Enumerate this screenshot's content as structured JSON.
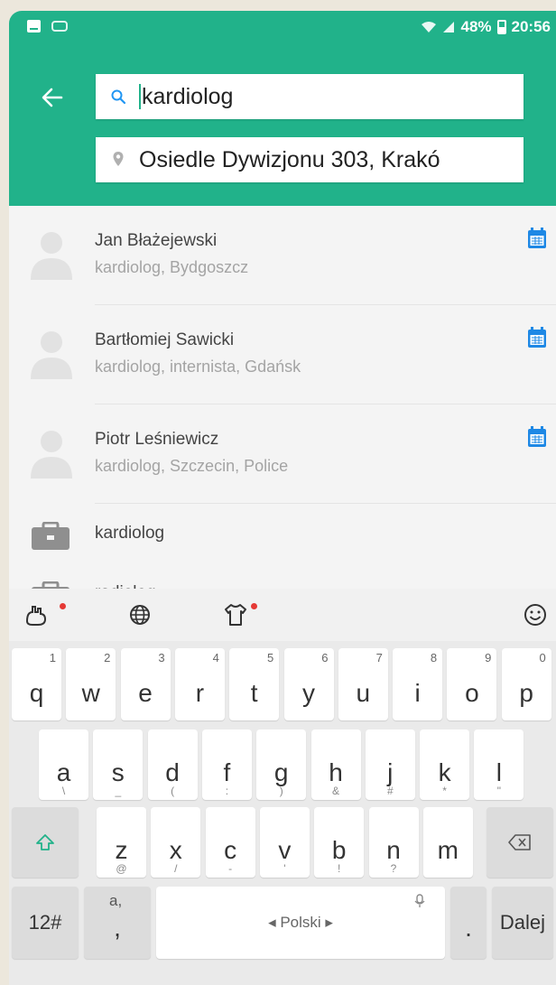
{
  "status_bar": {
    "battery": "48%",
    "time": "20:56"
  },
  "search": {
    "query": "kardiolog",
    "location": "Osiedle Dywizjonu 303, Krakó"
  },
  "colors": {
    "accent": "#21b28a",
    "calendar": "#1e88e5",
    "alert_dot": "#e53935"
  },
  "icons": {
    "back": "arrow-left-icon",
    "search": "search-icon",
    "location": "location-pin-icon",
    "calendar": "calendar-icon",
    "specialty": "briefcase-icon",
    "avatar": "person-placeholder-icon"
  },
  "results": [
    {
      "name": "Jan Błażejewski",
      "details": "kardiolog, Bydgoszcz"
    },
    {
      "name": "Bartłomiej Sawicki",
      "details": "kardiolog, internista, Gdańsk"
    },
    {
      "name": "Piotr Leśniewicz",
      "details": "kardiolog, Szczecin, Police"
    }
  ],
  "specialties": [
    "kardiolog",
    "radiolog"
  ],
  "keyboard": {
    "row1": [
      {
        "key": "q",
        "num": "1"
      },
      {
        "key": "w",
        "num": "2"
      },
      {
        "key": "e",
        "num": "3"
      },
      {
        "key": "r",
        "num": "4"
      },
      {
        "key": "t",
        "num": "5"
      },
      {
        "key": "y",
        "num": "6"
      },
      {
        "key": "u",
        "num": "7"
      },
      {
        "key": "i",
        "num": "8"
      },
      {
        "key": "o",
        "num": "9"
      },
      {
        "key": "p",
        "num": "0"
      }
    ],
    "row2": [
      {
        "key": "a",
        "hint": "\\"
      },
      {
        "key": "s",
        "hint": "_"
      },
      {
        "key": "d",
        "hint": "("
      },
      {
        "key": "f",
        "hint": ":"
      },
      {
        "key": "g",
        "hint": ")"
      },
      {
        "key": "h",
        "hint": "&"
      },
      {
        "key": "j",
        "hint": "#"
      },
      {
        "key": "k",
        "hint": "*"
      },
      {
        "key": "l",
        "hint": "\""
      }
    ],
    "row3": [
      {
        "key": "z",
        "hint": "@"
      },
      {
        "key": "x",
        "hint": "/"
      },
      {
        "key": "c",
        "hint": "-"
      },
      {
        "key": "v",
        "hint": "'"
      },
      {
        "key": "b",
        "hint": "!"
      },
      {
        "key": "n",
        "hint": "?"
      },
      {
        "key": "m",
        "hint": ""
      }
    ],
    "row4": {
      "symbols": "12#",
      "comma_top": "a,",
      "comma": ",",
      "space": "◂ Polski ▸",
      "period": ".",
      "enter": "Dalej"
    }
  }
}
